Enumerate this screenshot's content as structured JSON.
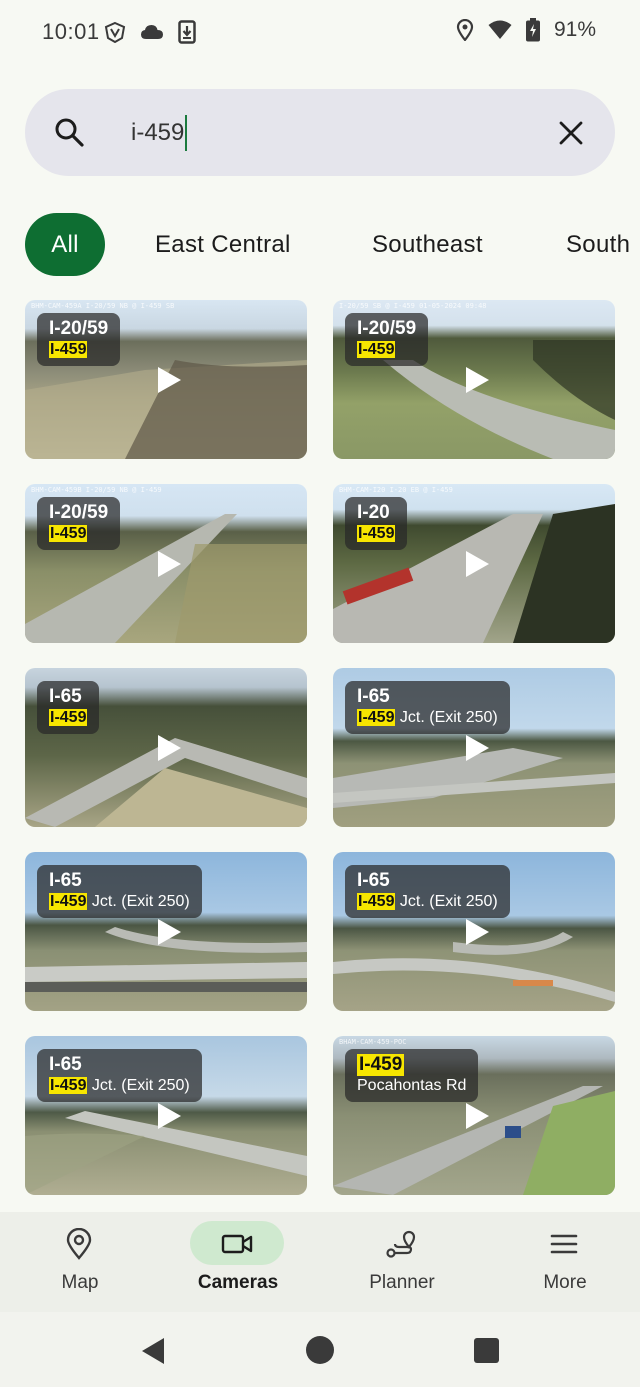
{
  "status_bar": {
    "time": "10:01",
    "battery": "91%",
    "icons": [
      "vpn-icon",
      "cloud-icon",
      "download-icon",
      "location-icon",
      "wifi-icon",
      "battery-icon"
    ]
  },
  "search": {
    "value": "i-459",
    "icon": "search-icon",
    "clear_icon": "close-icon"
  },
  "filters": {
    "chips": [
      {
        "label": "All",
        "active": true
      },
      {
        "label": "East Central",
        "active": false
      },
      {
        "label": "Southeast",
        "active": false
      },
      {
        "label": "South",
        "active": false
      }
    ]
  },
  "cameras": [
    {
      "route": "I-20/59",
      "highlight": "I-459",
      "detail": "",
      "caption": "BHM-CAM-459A   I-20/59 NB @ I-459 SB"
    },
    {
      "route": "I-20/59",
      "highlight": "I-459",
      "detail": "",
      "caption": "I-20/59 SB @ I-459   01-05-2024 09:48"
    },
    {
      "route": "I-20/59",
      "highlight": "I-459",
      "detail": "",
      "caption": "BHM-CAM-459B   I-20/59 NB @ I-459"
    },
    {
      "route": "I-20",
      "highlight": "I-459",
      "detail": "",
      "caption": "BHM-CAM-I20   I-20 EB @ I-459"
    },
    {
      "route": "I-65",
      "highlight": "I-459",
      "detail": "",
      "caption": ""
    },
    {
      "route": "I-65",
      "highlight": "I-459",
      "detail": " Jct. (Exit 250)",
      "caption": ""
    },
    {
      "route": "I-65",
      "highlight": "I-459",
      "detail": " Jct. (Exit 250)",
      "caption": ""
    },
    {
      "route": "I-65",
      "highlight": "I-459",
      "detail": " Jct. (Exit 250)",
      "caption": ""
    },
    {
      "route": "I-65",
      "highlight": "I-459",
      "detail": " Jct. (Exit 250)",
      "caption": ""
    },
    {
      "route": "",
      "highlight": "I-459",
      "detail": "Pocahontas Rd",
      "caption": "BHAM-CAM-459-POC"
    }
  ],
  "bottom_nav": [
    {
      "label": "Map",
      "icon": "map-pin-icon",
      "active": false
    },
    {
      "label": "Cameras",
      "icon": "video-camera-icon",
      "active": true
    },
    {
      "label": "Planner",
      "icon": "route-planner-icon",
      "active": false
    },
    {
      "label": "More",
      "icon": "menu-icon",
      "active": false
    }
  ],
  "colors": {
    "accent": "#0e6e32",
    "highlight": "#f7e600",
    "active_pill": "#cfe9cf"
  }
}
